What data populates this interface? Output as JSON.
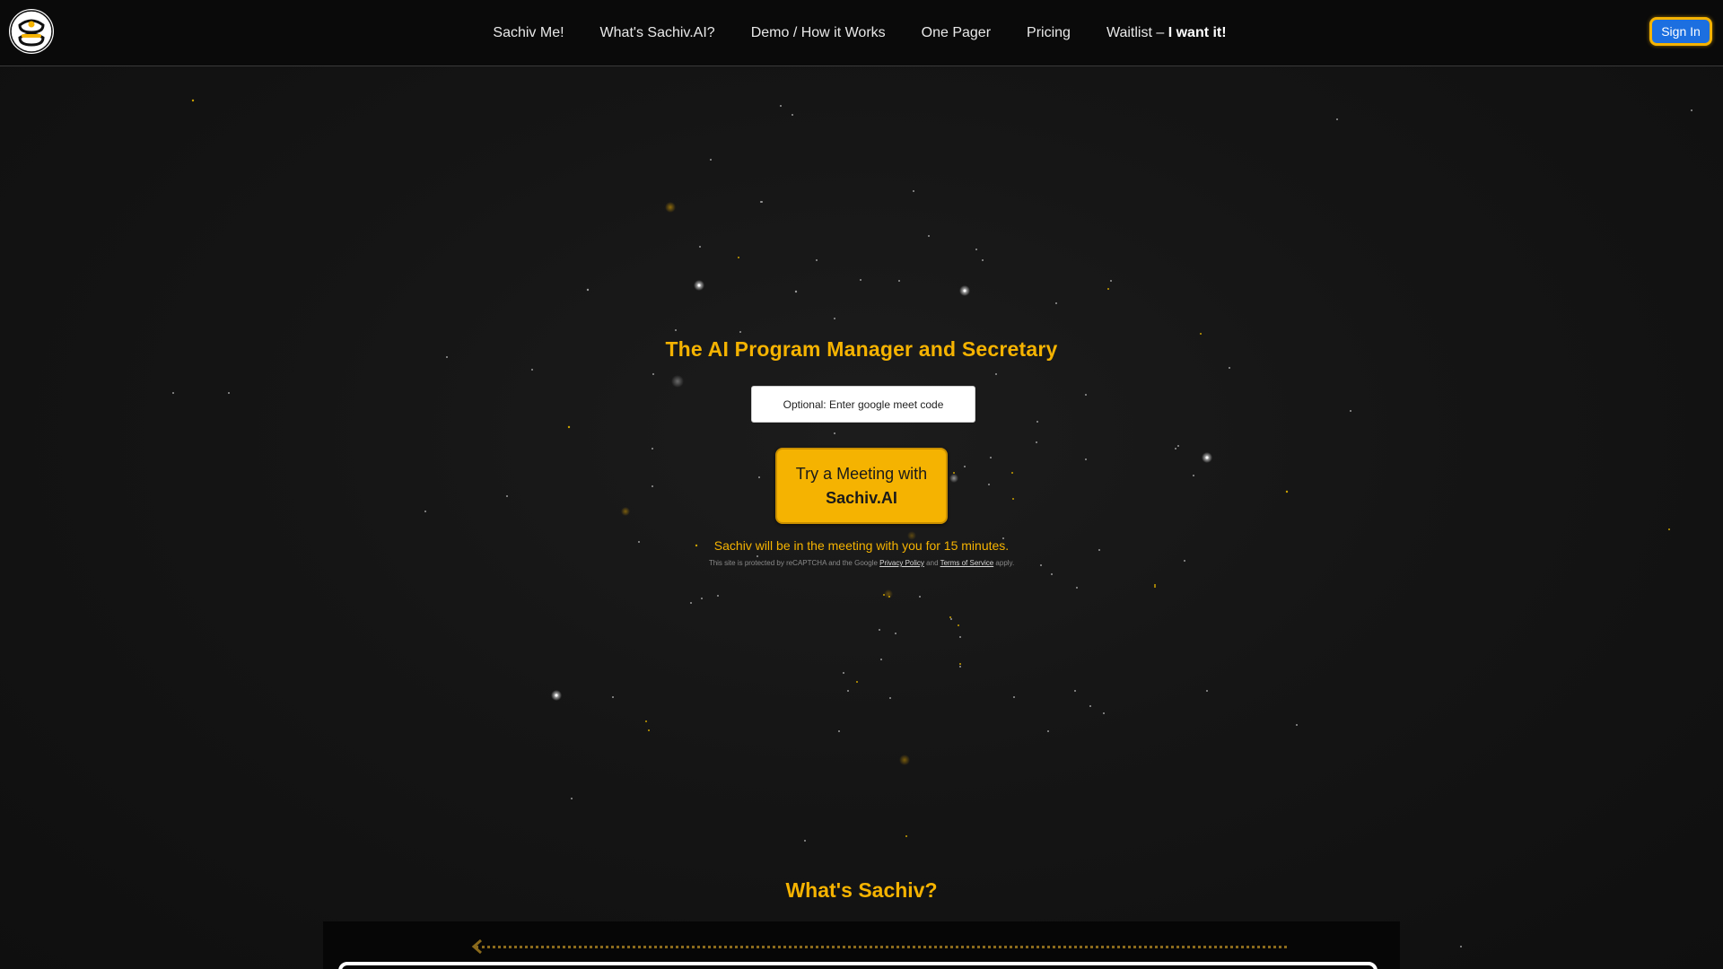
{
  "nav": {
    "links": [
      {
        "label": "Sachiv Me!"
      },
      {
        "label": "What's Sachiv.AI?"
      },
      {
        "label": "Demo / How it Works"
      },
      {
        "label": "One Pager"
      },
      {
        "label": "Pricing"
      }
    ],
    "waitlist_prefix": "Waitlist –",
    "waitlist_cta": "I want it!",
    "signin_label": "Sign In"
  },
  "hero": {
    "title": "The AI Program Manager and Secretary",
    "meet_input_placeholder": "Optional: Enter google meet code",
    "try_button_line1": "Try a Meeting with",
    "try_button_line2": "Sachiv.AI",
    "meeting_note": "Sachiv will be in the meeting with you for 15 minutes.",
    "recaptcha_prefix": "This site is protected by reCAPTCHA and the Google",
    "privacy_link": "Privacy Policy",
    "recaptcha_and": "and",
    "terms_link": "Terms of Service",
    "recaptcha_suffix": "apply."
  },
  "sections": {
    "whats_sachiv_title": "What's Sachiv?"
  },
  "colors": {
    "accent": "#f5b301",
    "signin_bg": "#1c6fe0",
    "background": "#141414",
    "header_bg": "#0a0a0a"
  },
  "icons": {
    "logo": "sachiv-logo-icon",
    "back_arrow": "chevron-left-icon"
  }
}
